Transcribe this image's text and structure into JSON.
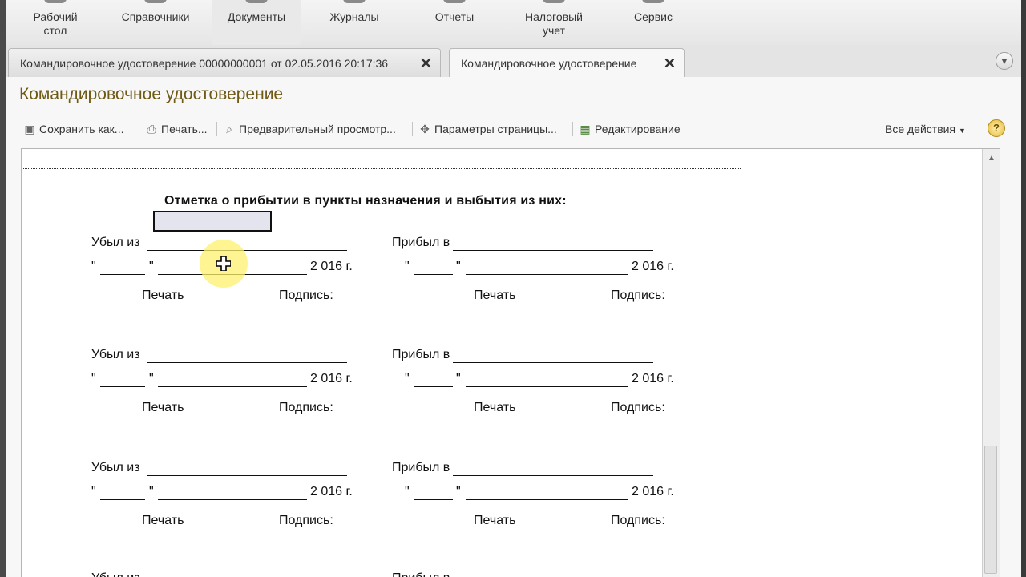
{
  "sections": [
    {
      "label": "Рабочий\nстол",
      "icon": "desktop-icon"
    },
    {
      "label": "Справочники",
      "icon": "book-icon"
    },
    {
      "label": "Документы",
      "icon": "document-icon"
    },
    {
      "label": "Журналы",
      "icon": "journal-icon"
    },
    {
      "label": "Отчеты",
      "icon": "report-icon"
    },
    {
      "label": "Налоговый\nучет",
      "icon": "tax-icon"
    },
    {
      "label": "Сервис",
      "icon": "service-icon"
    }
  ],
  "tabs": [
    {
      "label": "Командировочное удостоверение 00000000001 от 02.05.2016 20:17:36"
    },
    {
      "label": "Командировочное удостоверение"
    }
  ],
  "form": {
    "title": "Командировочное удостоверение",
    "toolbar": {
      "save": "Сохранить как...",
      "print": "Печать...",
      "preview": "Предварительный просмотр...",
      "page_settings": "Параметры страницы...",
      "edit": "Редактирование",
      "all_actions": "Все действия",
      "help": "?"
    }
  },
  "document": {
    "heading": "Отметка о прибытии в пункты назначения и выбытия из них:",
    "departed": "Убыл из",
    "arrived": "Прибыл в",
    "quote": "\"",
    "year": "2 016 г.",
    "stamp": "Печать",
    "signature": "Подпись:"
  },
  "colors": {
    "title": "#6e5a14",
    "selection": "#e3e4ee",
    "cursor_highlight": "#fff06e"
  }
}
